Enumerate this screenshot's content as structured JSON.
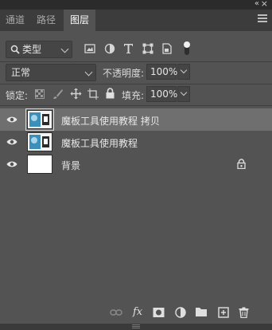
{
  "panel": {
    "collapse_glyph": "«",
    "close_glyph": "×"
  },
  "tabs": [
    {
      "label": "通道",
      "active": false
    },
    {
      "label": "路径",
      "active": false
    },
    {
      "label": "图层",
      "active": true
    }
  ],
  "filter": {
    "kind_label": "类型",
    "icons": [
      "image-filter-icon",
      "adjustment-filter-icon",
      "text-filter-icon",
      "shape-filter-icon",
      "smart-object-filter-icon",
      "filter-toggle-icon"
    ]
  },
  "blend": {
    "mode": "正常",
    "opacity_label": "不透明度:",
    "opacity_value": "100%"
  },
  "lock": {
    "label": "锁定:",
    "icons": [
      "lock-transparent-icon",
      "lock-paint-icon",
      "lock-position-icon",
      "lock-artboard-icon",
      "lock-all-icon"
    ],
    "fill_label": "填充:",
    "fill_value": "100%"
  },
  "layers": [
    {
      "name": "魔板工具使用教程 拷贝",
      "selected": true,
      "thumb": "image",
      "locked": false
    },
    {
      "name": "魔板工具使用教程",
      "selected": false,
      "thumb": "image",
      "locked": false
    },
    {
      "name": "背景",
      "selected": false,
      "thumb": "white",
      "locked": true
    }
  ],
  "bottom_icons": [
    "link-layers-icon",
    "fx-icon",
    "add-mask-icon",
    "adjustment-layer-icon",
    "new-group-icon",
    "new-layer-icon",
    "delete-icon"
  ],
  "fx_label": "fx",
  "colors": {
    "panel_bg": "#535353",
    "tabbar_bg": "#3c3c3c",
    "selected_row": "#6f6f6f"
  }
}
